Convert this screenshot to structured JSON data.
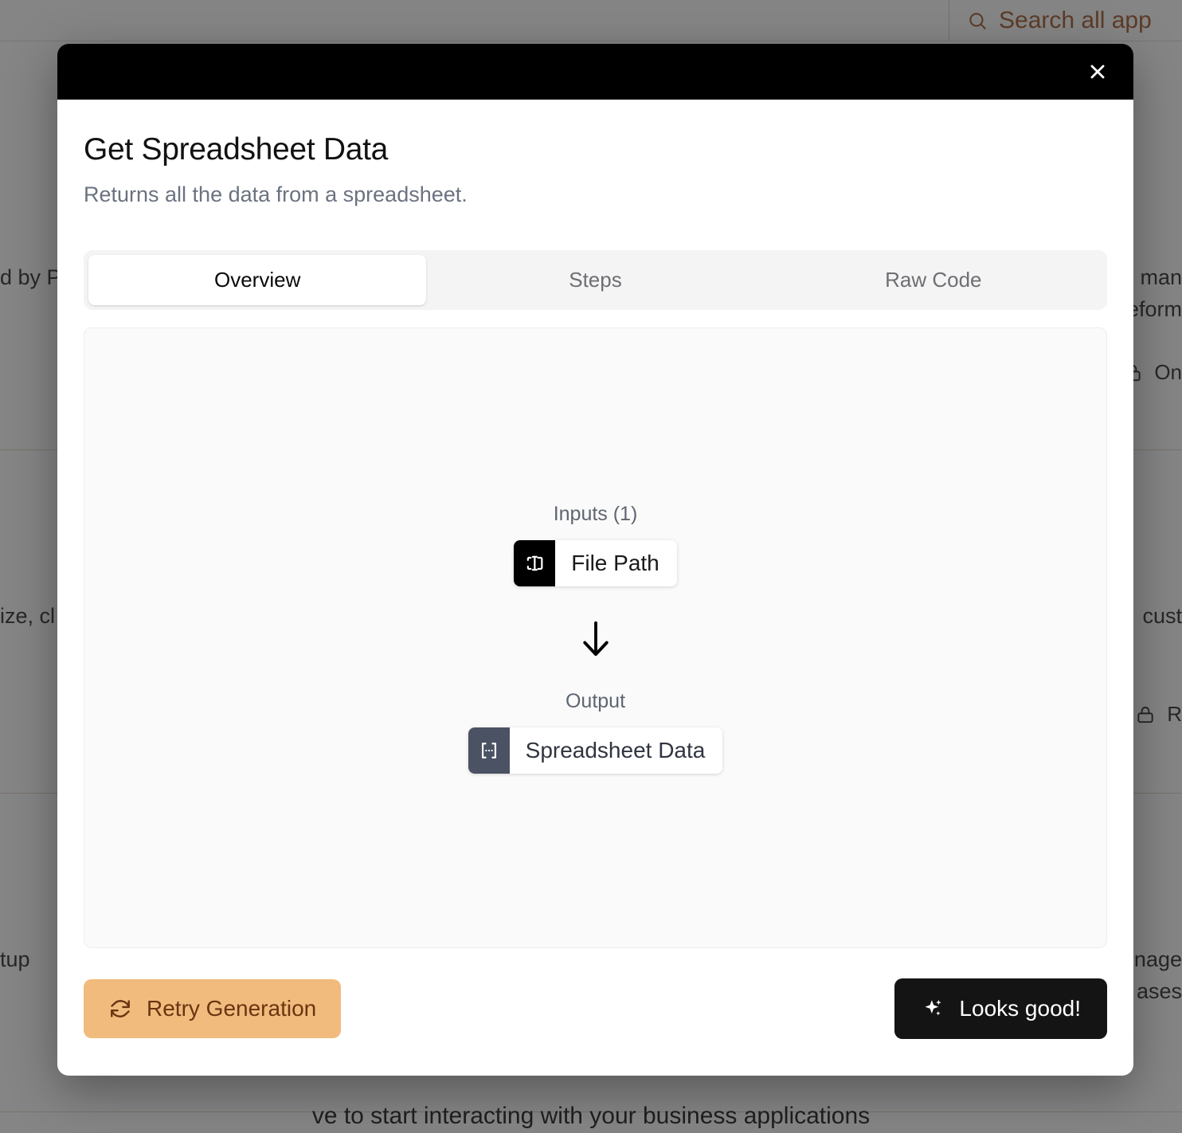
{
  "background": {
    "search": {
      "icon": "search-icon",
      "placeholder": "Search all app"
    },
    "rows": [
      {
        "desc_left": "d by P",
        "desc_right": "l man\neform",
        "meta_right": "On",
        "meta_icon": "lock-icon"
      },
      {
        "desc_left": "ize, cl",
        "desc_right": "cust",
        "meta_right": "R",
        "meta_icon": "lock-icon"
      },
      {
        "desc_left": "tup",
        "desc_right": "nage\nases",
        "meta_right": "",
        "meta_icon": "lock-icon"
      }
    ],
    "footnote": "ve to start interacting with your business applications"
  },
  "modal": {
    "close_label": "×",
    "title": "Get Spreadsheet Data",
    "subtitle": "Returns all the data from a spreadsheet.",
    "tabs": [
      {
        "label": "Overview",
        "active": true
      },
      {
        "label": "Steps",
        "active": false
      },
      {
        "label": "Raw Code",
        "active": false
      }
    ],
    "overview": {
      "inputs_label": "Inputs (1)",
      "inputs": [
        {
          "label": "File Path",
          "icon": "text-cursor-input-icon"
        }
      ],
      "arrow_icon": "arrow-down-icon",
      "output_label": "Output",
      "outputs": [
        {
          "label": "Spreadsheet Data",
          "icon": "brackets-ellipsis-icon"
        }
      ]
    },
    "footer": {
      "retry_label": "Retry Generation",
      "retry_icon": "refresh-cw-icon",
      "primary_label": "Looks good!",
      "primary_icon": "sparkles-icon"
    }
  },
  "colors": {
    "accent_orange": "#f0bb7d",
    "accent_orange_text": "#6b3411",
    "primary_dark": "#141414",
    "output_chip_icon_bg": "#4a5263",
    "input_chip_icon_bg": "#000000",
    "muted_text": "#6b7280"
  }
}
